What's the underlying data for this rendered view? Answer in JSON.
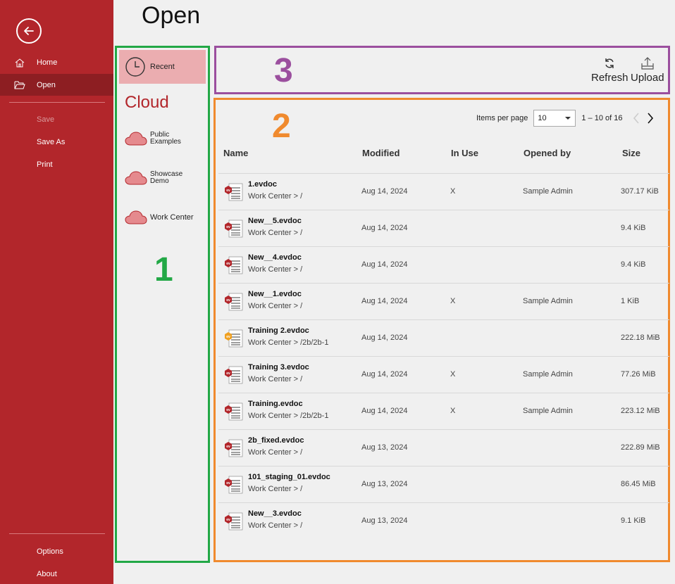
{
  "page_title": "Open",
  "sidebar": {
    "items": [
      {
        "label": "Home"
      },
      {
        "label": "Open"
      },
      {
        "label": "Save"
      },
      {
        "label": "Save As"
      },
      {
        "label": "Print"
      },
      {
        "label": "Options"
      },
      {
        "label": "About"
      }
    ]
  },
  "locations": {
    "recent": "Recent",
    "cloud_heading": "Cloud",
    "items": [
      {
        "label1": "Public",
        "label2": "Examples"
      },
      {
        "label1": "Showcase",
        "label2": "Demo"
      },
      {
        "label1": "Work Center",
        "label2": ""
      }
    ]
  },
  "annotations": {
    "one": "1",
    "two": "2",
    "three": "3"
  },
  "toolbar": {
    "refresh": "Refresh",
    "upload": "Upload"
  },
  "pager": {
    "items_per_page_label": "Items per page",
    "items_per_page_value": "10",
    "range": "1 – 10 of 16"
  },
  "table": {
    "headers": {
      "name": "Name",
      "modified": "Modified",
      "in_use": "In Use",
      "opened_by": "Opened by",
      "size": "Size"
    },
    "rows": [
      {
        "name": "1.evdoc",
        "path": "Work Center > /",
        "modified": "Aug 14, 2024",
        "in_use": "X",
        "opened_by": "Sample Admin",
        "size": "307.17 KiB",
        "icon_color": "#b2262b"
      },
      {
        "name": "New__5.evdoc",
        "path": "Work Center > /",
        "modified": "Aug 14, 2024",
        "in_use": "",
        "opened_by": "",
        "size": "9.4 KiB",
        "icon_color": "#b2262b"
      },
      {
        "name": "New__4.evdoc",
        "path": "Work Center > /",
        "modified": "Aug 14, 2024",
        "in_use": "",
        "opened_by": "",
        "size": "9.4 KiB",
        "icon_color": "#b2262b"
      },
      {
        "name": "New__1.evdoc",
        "path": "Work Center > /",
        "modified": "Aug 14, 2024",
        "in_use": "X",
        "opened_by": "Sample Admin",
        "size": "1 KiB",
        "icon_color": "#b2262b"
      },
      {
        "name": "Training 2.evdoc",
        "path": "Work Center > /2b/2b-1",
        "modified": "Aug 14, 2024",
        "in_use": "",
        "opened_by": "",
        "size": "222.18 MiB",
        "icon_color": "#f0a020"
      },
      {
        "name": "Training 3.evdoc",
        "path": "Work Center > /",
        "modified": "Aug 14, 2024",
        "in_use": "X",
        "opened_by": "Sample Admin",
        "size": "77.26 MiB",
        "icon_color": "#b2262b"
      },
      {
        "name": "Training.evdoc",
        "path": "Work Center > /2b/2b-1",
        "modified": "Aug 14, 2024",
        "in_use": "X",
        "opened_by": "Sample Admin",
        "size": "223.12 MiB",
        "icon_color": "#b2262b"
      },
      {
        "name": "2b_fixed.evdoc",
        "path": "Work Center > /",
        "modified": "Aug 13, 2024",
        "in_use": "",
        "opened_by": "",
        "size": "222.89 MiB",
        "icon_color": "#b2262b"
      },
      {
        "name": "101_staging_01.evdoc",
        "path": "Work Center > /",
        "modified": "Aug 13, 2024",
        "in_use": "",
        "opened_by": "",
        "size": "86.45 MiB",
        "icon_color": "#b2262b"
      },
      {
        "name": "New__3.evdoc",
        "path": "Work Center > /",
        "modified": "Aug 13, 2024",
        "in_use": "",
        "opened_by": "",
        "size": "9.1 KiB",
        "icon_color": "#b2262b"
      }
    ]
  },
  "file_icon_text": "ev",
  "colors": {
    "brand": "#b2262b",
    "panel1": "#22a846",
    "panel2": "#f08a2e",
    "panel3": "#9b4f9e"
  }
}
